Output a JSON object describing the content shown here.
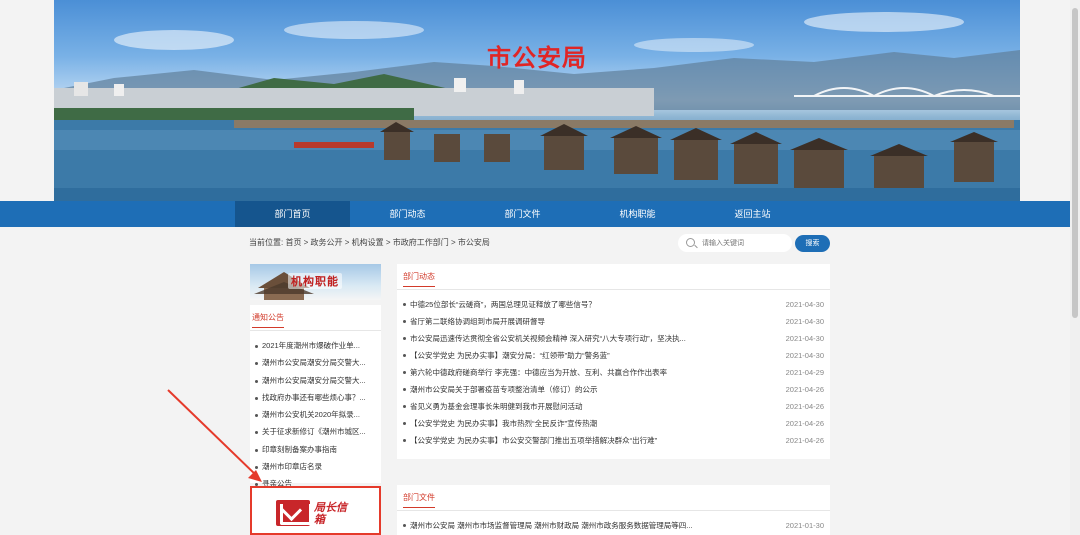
{
  "banner": {
    "title": "市公安局"
  },
  "nav": [
    {
      "label": "部门首页"
    },
    {
      "label": "部门动态"
    },
    {
      "label": "部门文件"
    },
    {
      "label": "机构职能"
    },
    {
      "label": "返回主站"
    }
  ],
  "breadcrumb": "当前位置: 首页 > 政务公开 > 机构设置 > 市政府工作部门 > 市公安局",
  "search": {
    "placeholder": "请输入关键词",
    "button_label": "搜索"
  },
  "side_banner_label": "机构职能",
  "notice": {
    "heading": "通知公告",
    "items": [
      "2021年度潮州市爆破作业单...",
      "潮州市公安局潮安分局交警大...",
      "潮州市公安局潮安分局交警大...",
      "找政府办事还有哪些烦心事？...",
      "潮州市公安机关2020年拟录...",
      "关于征求新修订《潮州市城区...",
      "印章刻制备案办事指南",
      "潮州市印章店名录",
      "寻亲公告"
    ]
  },
  "mailbox_label": "局长信箱",
  "dept_news": {
    "heading": "部门动态",
    "items": [
      {
        "title": "中德25位部长“云磋商”，两国总理见证释放了哪些信号？",
        "date": "2021-04-30"
      },
      {
        "title": "省厅第二联络协调组到市局开展调研督导",
        "date": "2021-04-30"
      },
      {
        "title": "市公安局迅速传达贯彻全省公安机关视频会精神 深入研究“八大专项行动”，坚决执...",
        "date": "2021-04-30"
      },
      {
        "title": "【公安学党史 为民办实事】潮安分局：“红领带”助力“警务蓝”",
        "date": "2021-04-30"
      },
      {
        "title": "第六轮中德政府磋商举行 李克强：中德应当为开放、互利、共赢合作作出表率",
        "date": "2021-04-29"
      },
      {
        "title": "潮州市公安局关于部署疫苗专项整治清单（修订）的公示",
        "date": "2021-04-26"
      },
      {
        "title": "省见义勇为基金会理事长朱明健到我市开展慰问活动",
        "date": "2021-04-26"
      },
      {
        "title": "【公安学党史 为民办实事】我市热烈“全民反诈”宣传热潮",
        "date": "2021-04-26"
      },
      {
        "title": "【公安学党史 为民办实事】市公安交警部门推出五项举措解决群众“出行难”",
        "date": "2021-04-26"
      }
    ]
  },
  "dept_files": {
    "heading": "部门文件",
    "items": [
      {
        "title": "潮州市公安局 潮州市市场监督管理局 潮州市财政局 潮州市政务服务数据管理局等四...",
        "date": "2021-01-30"
      }
    ]
  }
}
